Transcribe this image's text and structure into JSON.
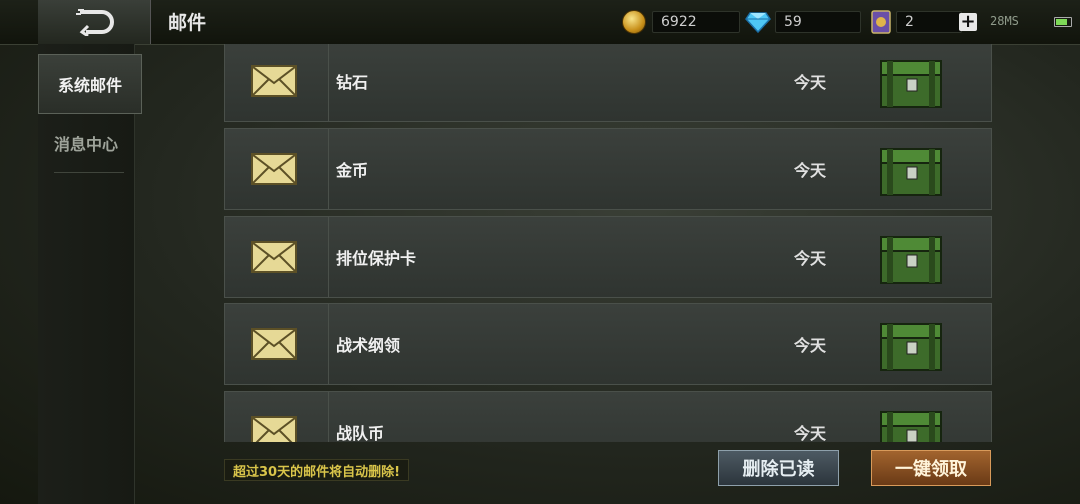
{
  "header": {
    "title": "邮件",
    "back_icon": "back-arrow-icon",
    "gold": "6922",
    "diamonds": "59",
    "cards": "2",
    "ping": "28MS"
  },
  "sidebar": {
    "items": [
      {
        "label": "系统邮件",
        "active": true
      },
      {
        "label": "消息中心",
        "active": false
      }
    ]
  },
  "mails": [
    {
      "subject": "钻石",
      "date": "今天"
    },
    {
      "subject": "金币",
      "date": "今天"
    },
    {
      "subject": "排位保护卡",
      "date": "今天"
    },
    {
      "subject": "战术纲领",
      "date": "今天"
    },
    {
      "subject": "战队币",
      "date": "今天"
    }
  ],
  "footer": {
    "notice": "超过30天的邮件将自动删除!",
    "delete_read": "删除已读",
    "claim_all": "一键领取"
  },
  "colors": {
    "accent_claim": "#8a4e22",
    "accent_delete": "#3d4850",
    "notice_text": "#d9c44a"
  }
}
